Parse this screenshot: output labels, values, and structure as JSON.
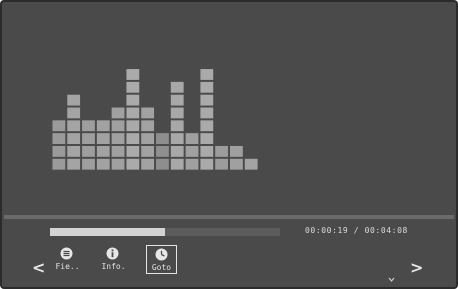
{
  "player": {
    "elapsed": "00:00:19",
    "total": "00:04:08",
    "time_readout": "00:00:19 / 00:04:08",
    "progress_fraction": 0.5
  },
  "visualizer": {
    "bar_levels": [
      4,
      6,
      4,
      4,
      5,
      8,
      5,
      3,
      7,
      3,
      8,
      2,
      2,
      1
    ],
    "bar_shades": [
      "#9a9a9a",
      "#a4a4a4",
      "#9e9e9e",
      "#a2a2a2",
      "#a0a0a0",
      "#aaaaaa",
      "#a2a2a2",
      "#8e8e8e",
      "#a8a8a8",
      "#a0a0a0",
      "#aaaaaa",
      "#9c9c9c",
      "#a0a0a0",
      "#a4a4a4"
    ]
  },
  "toolbar": {
    "file_label": "Fie..",
    "info_label": "Info.",
    "goto_label": "Goto",
    "file_icon": "list-icon",
    "info_icon": "info-icon",
    "goto_icon": "clock-icon"
  },
  "navigation": {
    "prev_glyph": "<",
    "next_glyph": ">"
  },
  "colors": {
    "screen_bg": "#4a4a4a",
    "accent": "#e4e4e4"
  }
}
